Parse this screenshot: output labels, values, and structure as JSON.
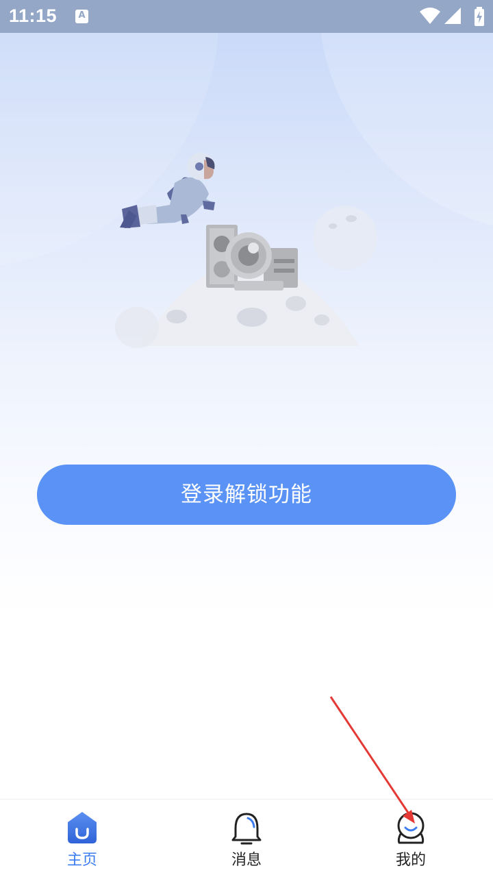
{
  "status_bar": {
    "time": "11:15",
    "notification_icon": "a-text-icon",
    "icons": [
      "wifi-icon",
      "signal-icon",
      "battery-charging-icon"
    ]
  },
  "main": {
    "illustration": "astronaut-moon-camera-illustration",
    "login_button_label": "登录解锁功能"
  },
  "tab_bar": {
    "tabs": [
      {
        "label": "主页",
        "icon": "home-icon",
        "active": true
      },
      {
        "label": "消息",
        "icon": "bell-icon",
        "active": false
      },
      {
        "label": "我的",
        "icon": "user-icon",
        "active": false
      }
    ]
  },
  "colors": {
    "accent": "#5a92f5",
    "active_tab": "#3b7cf0",
    "status_bar": "#95a7c7",
    "annotation_arrow": "#e53935"
  }
}
